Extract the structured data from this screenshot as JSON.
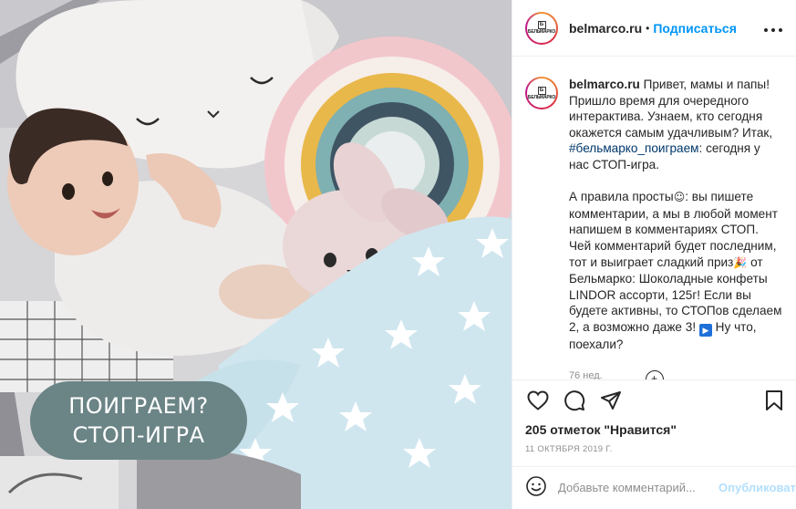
{
  "photo": {
    "overlay_line1": "ПОИГРАЕМ?",
    "overlay_line2": "СТОП-ИГРА"
  },
  "header": {
    "avatar_logo_letter": "Б",
    "avatar_logo_text": "БЕЛЬМАРКО",
    "username": "belmarco.ru",
    "separator": "•",
    "follow_label": "Подписаться",
    "more_icon": "more-horizontal-icon"
  },
  "caption": {
    "username": "belmarco.ru",
    "intro": "Привет, мамы и папы! Пришло время для очередного интерактива. Узнаем, кто сегодня окажется самым удачливым? Итак,",
    "hashtag": "#бельмарко_поиграем",
    "intro_end": ": сегодня у нас СТОП-игра.",
    "rules_start": "А правила просты",
    "smile_emoji": "☺",
    "rules_mid": ": вы пишете комментарии, а мы в любой момент напишем в комментариях СТОП. Чей комментарий будет последним, тот и выиграет сладкий приз",
    "party_emoji": "🎉",
    "rules_end": " от Бельмарко: Шоколадные конфеты LINDOR ассорти, 125г! Если вы будете активны, то СТОПов сделаем 2, а возможно даже 3!",
    "play_emoji": "▶",
    "closing": " Ну что, поехали?",
    "time_ago": "76 нед.",
    "load_more_icon": "+"
  },
  "actions": {
    "like_icon": "heart-icon",
    "comment_icon": "comment-icon",
    "share_icon": "share-icon",
    "save_icon": "bookmark-icon"
  },
  "likes": {
    "count_text": "205 отметок",
    "label": "\"Нравится\""
  },
  "date": "11 ОКТЯБРЯ 2019 Г.",
  "comment": {
    "emoji_icon": "smiley-icon",
    "placeholder": "Добавьте комментарий...",
    "publish_label": "Опубликовать"
  }
}
